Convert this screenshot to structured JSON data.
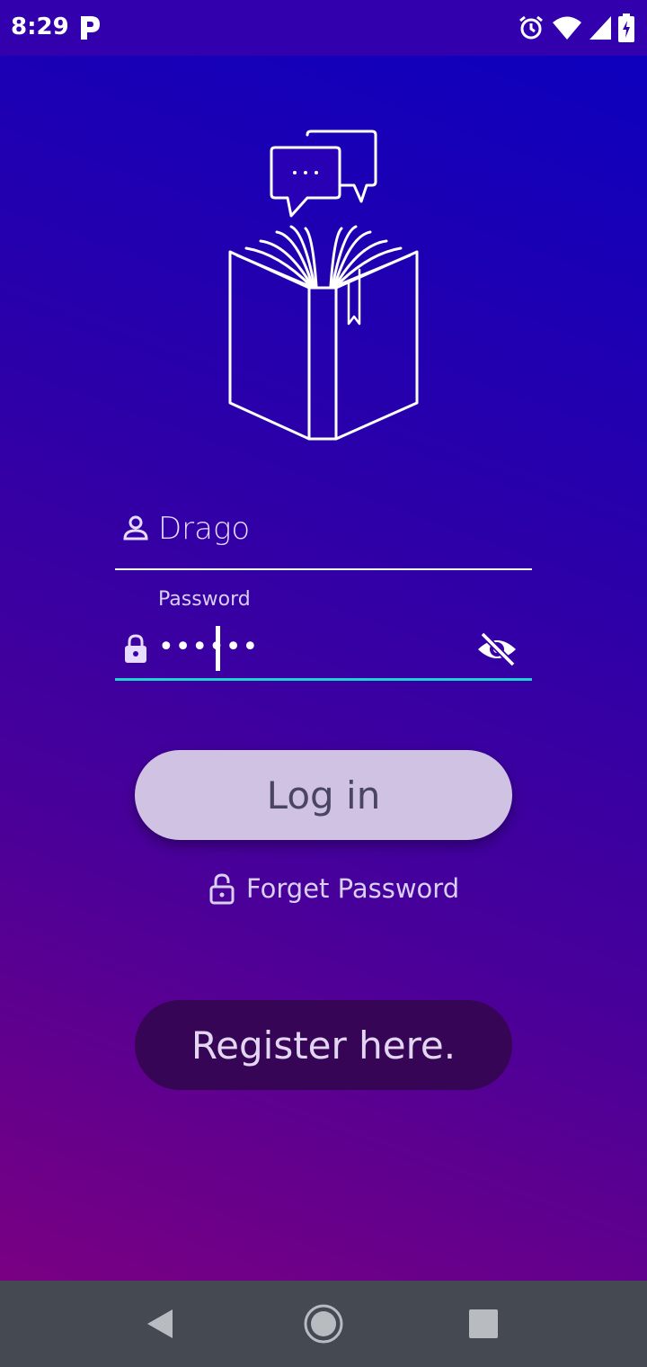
{
  "status_bar": {
    "time": "8:29",
    "icons": [
      "parking-icon",
      "alarm-icon",
      "wifi-icon",
      "signal-icon",
      "battery-icon"
    ]
  },
  "login_form": {
    "username": {
      "value": "Drago",
      "icon": "person-icon"
    },
    "password": {
      "label": "Password",
      "masked_value": "••••••",
      "icon": "lock-icon",
      "toggle_icon": "eye-off-icon"
    },
    "login_label": "Log in",
    "forgot_label": "Forget Password",
    "register_label": "Register here."
  },
  "nav_bar": {
    "icons": [
      "back-icon",
      "home-icon",
      "recents-icon"
    ]
  },
  "colors": {
    "accent_underline": "#1fd3d3",
    "login_button": "#cfc2e3",
    "register_button": "#360556",
    "status_bar": "#3200ad",
    "nav_bar": "#454a52"
  }
}
